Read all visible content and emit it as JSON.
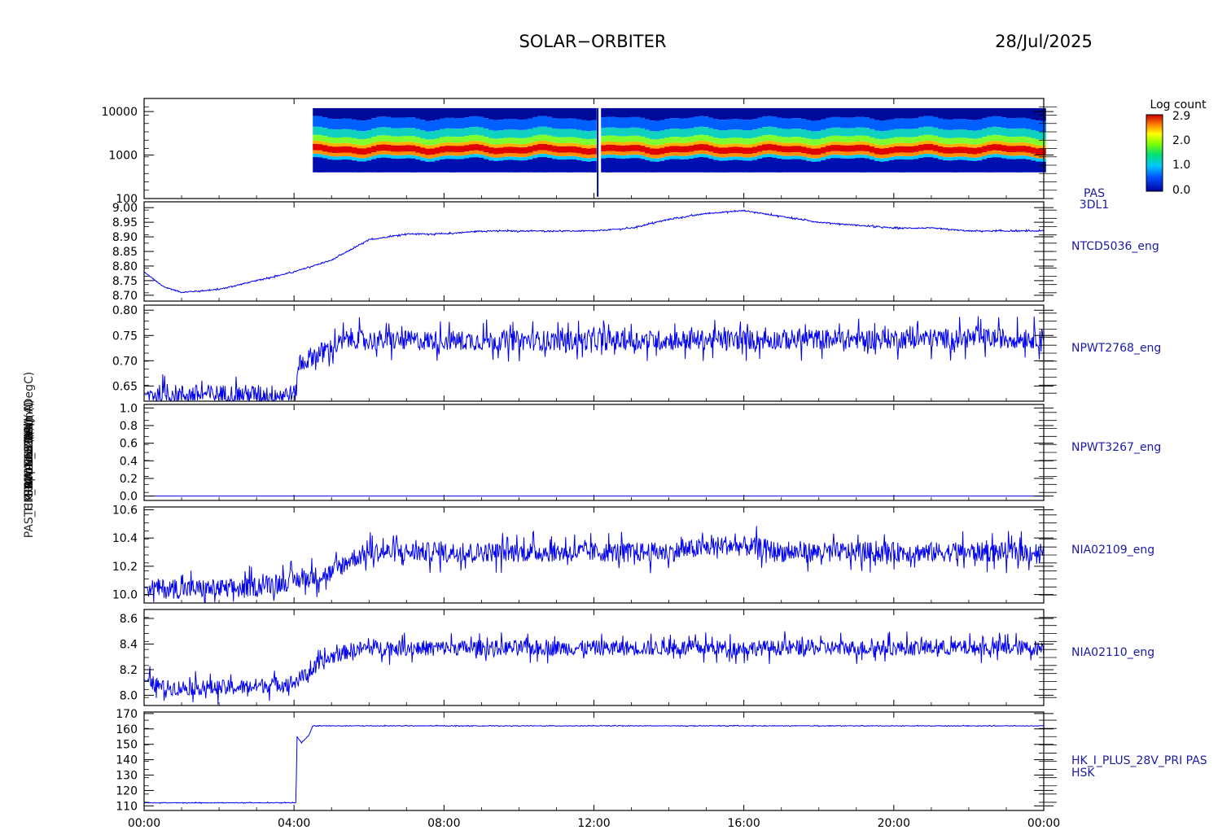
{
  "header": {
    "title": "SOLAR−ORBITER",
    "date": "28/Jul/2025"
  },
  "colors": {
    "trace": "#0000ee",
    "frame": "#000000",
    "label": "#1a1aa6"
  },
  "chart_data": {
    "type": "line",
    "x_axis": {
      "ticks": [
        "00:00",
        "04:00",
        "08:00",
        "12:00",
        "16:00",
        "20:00",
        "00:00"
      ],
      "range_hours": [
        0,
        24
      ]
    },
    "ylabels_overlapped": [
      "Ion (eV)",
      "TCM Approx Temp (DegC)",
      "SWA-EAS-PSU(A)",
      "SWA-HTR(A)",
      "RPW-LCL1(A)",
      "RPW-LCL2(A)",
      "PAS_HK_IMON_28V (mA)"
    ],
    "colorbar": {
      "label": "Log count",
      "ticks": [
        "2.9",
        "2.0",
        "1.0",
        "0.0"
      ],
      "range": [
        0.0,
        2.9
      ]
    },
    "panels": [
      {
        "id": "pas-3dl1",
        "type": "heatmap",
        "yscale": "log",
        "ylim": [
          100,
          20000
        ],
        "yticks": [
          "10000",
          "1000",
          "100"
        ],
        "yticks_values": [
          10000,
          1000,
          100
        ],
        "right_label": [
          "PAS",
          "3DL1"
        ],
        "data_start_hour": 4.5,
        "gap_hour": 12.1,
        "peak_energy_ev": 1400,
        "band_low_ev": 400,
        "band_high_ev": 12000
      },
      {
        "id": "ntcd5036",
        "type": "line",
        "ylim": [
          8.68,
          9.02
        ],
        "yticks": [
          "9.00",
          "8.95",
          "8.90",
          "8.85",
          "8.80",
          "8.75",
          "8.70"
        ],
        "yticks_values": [
          9.0,
          8.95,
          8.9,
          8.85,
          8.8,
          8.75,
          8.7
        ],
        "right_label": [
          "NTCD5036_eng"
        ],
        "x": [
          0,
          0.5,
          1,
          2,
          3,
          4,
          5,
          6,
          7,
          8,
          9,
          10,
          11,
          12,
          13,
          14,
          15,
          16,
          17,
          18,
          19,
          20,
          21,
          22,
          23,
          24
        ],
        "y": [
          8.78,
          8.73,
          8.71,
          8.72,
          8.75,
          8.78,
          8.82,
          8.89,
          8.91,
          8.91,
          8.92,
          8.92,
          8.92,
          8.92,
          8.93,
          8.96,
          8.98,
          8.99,
          8.97,
          8.95,
          8.94,
          8.93,
          8.93,
          8.92,
          8.92,
          8.92
        ],
        "noise": 0.002
      },
      {
        "id": "npwt2768",
        "type": "line",
        "ylim": [
          0.62,
          0.81
        ],
        "yticks": [
          "0.80",
          "0.75",
          "0.70",
          "0.65"
        ],
        "yticks_values": [
          0.8,
          0.75,
          0.7,
          0.65
        ],
        "right_label": [
          "NPWT2768_eng"
        ],
        "x": [
          0,
          4.05,
          4.1,
          4.5,
          5.0,
          5.5,
          6,
          12,
          24
        ],
        "y": [
          0.633,
          0.633,
          0.69,
          0.71,
          0.725,
          0.745,
          0.74,
          0.74,
          0.745
        ],
        "noise": 0.02
      },
      {
        "id": "npwt3267",
        "type": "line",
        "ylim": [
          -0.05,
          1.04
        ],
        "yticks": [
          "1.0",
          "0.8",
          "0.6",
          "0.4",
          "0.2",
          "0.0"
        ],
        "yticks_values": [
          1.0,
          0.8,
          0.6,
          0.4,
          0.2,
          0.0
        ],
        "right_label": [
          "NPWT3267_eng"
        ],
        "x": [
          0,
          24
        ],
        "y": [
          0.0,
          0.0
        ],
        "noise": 0.0
      },
      {
        "id": "nia02109",
        "type": "line",
        "ylim": [
          9.94,
          10.62
        ],
        "yticks": [
          "10.6",
          "10.4",
          "10.2",
          "10.0"
        ],
        "yticks_values": [
          10.6,
          10.4,
          10.2,
          10.0
        ],
        "right_label": [
          "NIA02109_eng"
        ],
        "x": [
          0,
          0.5,
          2.5,
          4,
          5,
          5.5,
          6,
          12,
          14,
          15.5,
          16.5,
          17,
          24
        ],
        "y": [
          10.05,
          10.04,
          10.04,
          10.1,
          10.15,
          10.25,
          10.3,
          10.3,
          10.3,
          10.35,
          10.33,
          10.3,
          10.3
        ],
        "noise": 0.07
      },
      {
        "id": "nia02110",
        "type": "line",
        "ylim": [
          7.92,
          8.67
        ],
        "yticks": [
          "8.6",
          "8.4",
          "8.2",
          "8.0"
        ],
        "yticks_values": [
          8.6,
          8.4,
          8.2,
          8.0
        ],
        "right_label": [
          "NIA02110_eng"
        ],
        "x": [
          0,
          0.5,
          2.5,
          4,
          4.5,
          5,
          5.5,
          6,
          12,
          24
        ],
        "y": [
          8.12,
          8.06,
          8.06,
          8.1,
          8.2,
          8.3,
          8.35,
          8.37,
          8.37,
          8.37
        ],
        "noise": 0.06
      },
      {
        "id": "hk-i-plus-28v",
        "type": "line",
        "ylim": [
          107,
          171
        ],
        "yticks": [
          "170",
          "160",
          "150",
          "140",
          "130",
          "120",
          "110"
        ],
        "yticks_values": [
          170,
          160,
          150,
          140,
          130,
          120,
          110
        ],
        "right_label": [
          "HK_I_PLUS_28V_PRI PAS",
          "HSK"
        ],
        "x": [
          0,
          4.05,
          4.08,
          4.2,
          4.4,
          4.5,
          24
        ],
        "y": [
          112,
          112,
          155,
          151,
          156,
          162,
          162
        ],
        "noise": 0.2
      }
    ]
  }
}
